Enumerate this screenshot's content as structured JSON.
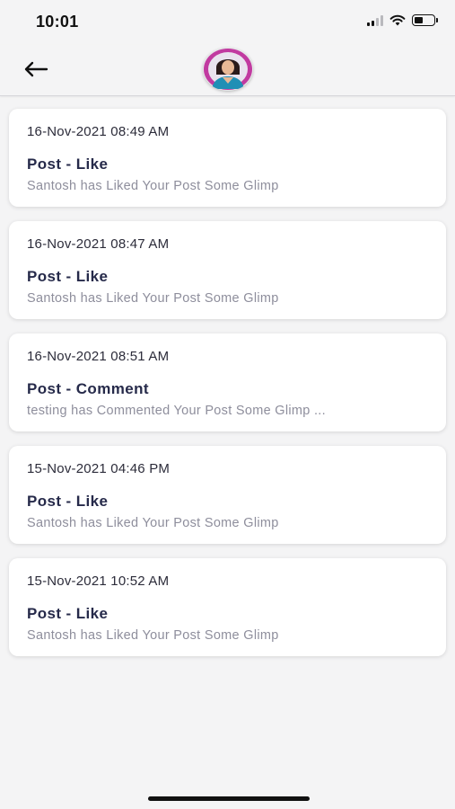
{
  "status_bar": {
    "time": "10:01",
    "battery_level": 0.45
  },
  "header": {
    "back_icon": "arrow-left-icon",
    "avatar": "user-avatar"
  },
  "notifications": [
    {
      "date": "16-Nov-2021 08:49 AM",
      "title": "Post - Like",
      "body": "Santosh has Liked Your Post Some Glimp"
    },
    {
      "date": "16-Nov-2021 08:47 AM",
      "title": "Post - Like",
      "body": "Santosh has Liked Your Post Some Glimp"
    },
    {
      "date": "16-Nov-2021 08:51 AM",
      "title": "Post - Comment",
      "body": "testing has Commented Your Post Some Glimp ..."
    },
    {
      "date": "15-Nov-2021 04:46 PM",
      "title": "Post - Like",
      "body": "Santosh has Liked Your Post Some Glimp"
    },
    {
      "date": "15-Nov-2021 10:52 AM",
      "title": "Post - Like",
      "body": "Santosh has Liked Your Post Some Glimp"
    }
  ]
}
